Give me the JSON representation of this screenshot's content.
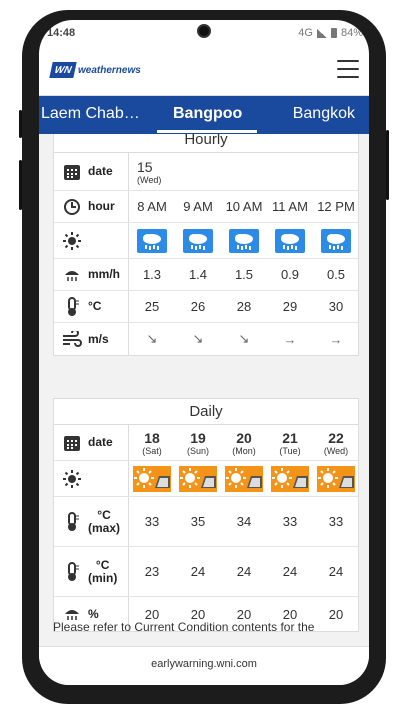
{
  "status": {
    "time": "14:48",
    "network": "4G",
    "battery": "84%"
  },
  "header": {
    "logo_mark": "WN",
    "logo_name": "weathernews"
  },
  "tabs": {
    "left": "Laem Chab…",
    "center": "Bangpoo",
    "right": "Bangkok"
  },
  "hourly": {
    "title": "Hourly",
    "labels": {
      "date": "date",
      "hour": "hour",
      "rain": "mm/h",
      "temp": "°C",
      "wind": "m/s"
    },
    "date": {
      "day": "15",
      "weekday": "(Wed)"
    },
    "hours": [
      "8 AM",
      "9 AM",
      "10 AM",
      "11 AM",
      "12 PM"
    ],
    "rain": [
      "1.3",
      "1.4",
      "1.5",
      "0.9",
      "0.5"
    ],
    "temp": [
      "25",
      "26",
      "28",
      "29",
      "30"
    ],
    "wind": [
      "↘",
      "↘",
      "↘",
      "→",
      "→"
    ]
  },
  "daily": {
    "title": "Daily",
    "labels": {
      "date": "date",
      "max_unit": "°C",
      "max": "(max)",
      "min_unit": "°C",
      "min": "(min)",
      "pop": "%"
    },
    "days": [
      {
        "day": "18",
        "weekday": "(Sat)"
      },
      {
        "day": "19",
        "weekday": "(Sun)"
      },
      {
        "day": "20",
        "weekday": "(Mon)"
      },
      {
        "day": "21",
        "weekday": "(Tue)"
      },
      {
        "day": "22",
        "weekday": "(Wed)"
      }
    ],
    "max": [
      "33",
      "35",
      "34",
      "33",
      "33"
    ],
    "min": [
      "23",
      "24",
      "24",
      "24",
      "24"
    ],
    "pop": [
      "20",
      "20",
      "20",
      "20",
      "20"
    ]
  },
  "note": "Please refer to Current Condition contents for the",
  "footer": "earlywarning.wni.com",
  "colors": {
    "brand": "#1a4a9e",
    "rain_icon": "#2d8be8",
    "sun_icon": "#f39419"
  }
}
